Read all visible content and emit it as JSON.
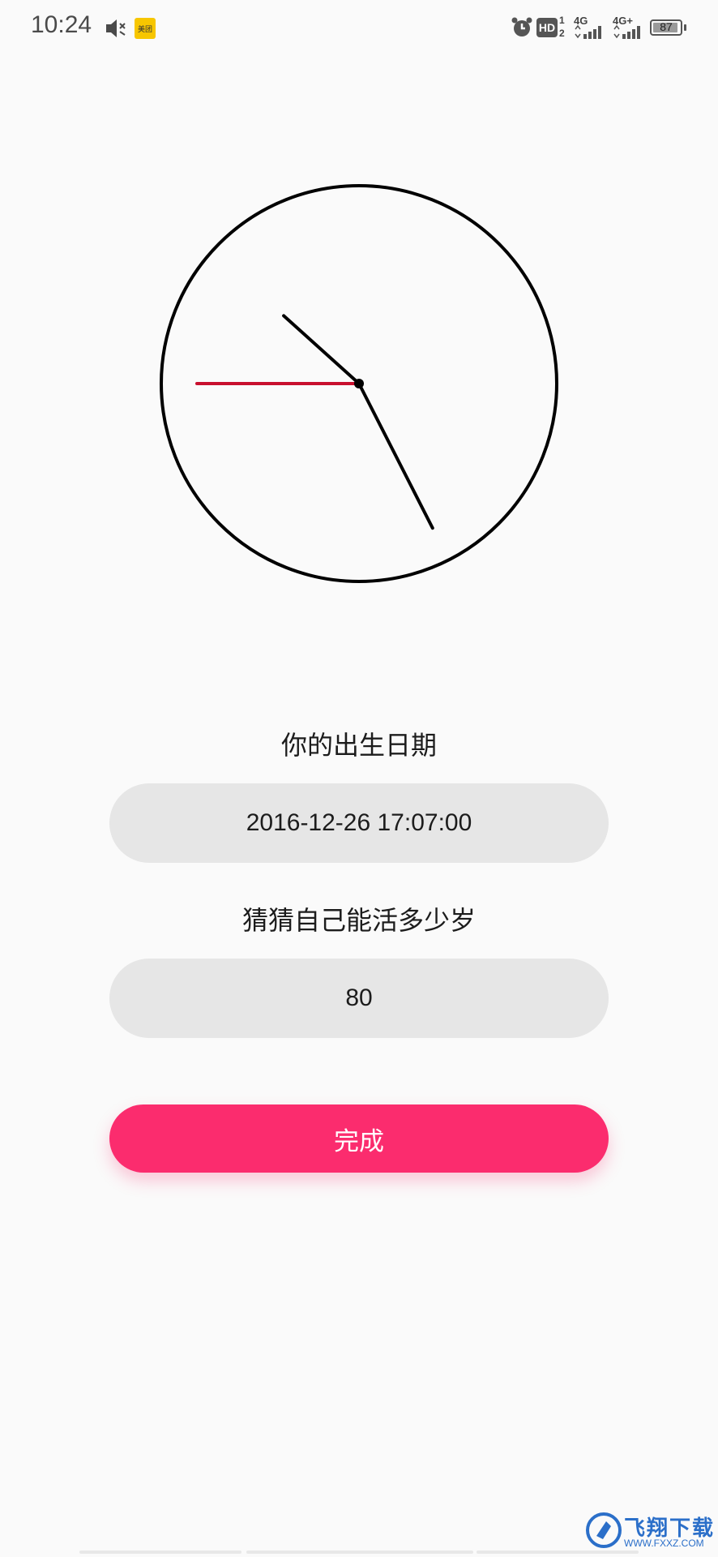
{
  "status_bar": {
    "time": "10:24",
    "app_icon_text": "美团",
    "hd_badge": "HD",
    "sim1_network": "4G",
    "sim2_network": "4G+",
    "battery_level": "87"
  },
  "clock": {
    "hour_hand_minutes": 52,
    "minute_hand_minutes": 25.5,
    "second_hand_seconds": 45,
    "colors": {
      "face": "#000000",
      "hands": "#000000",
      "second_hand": "#c8102e"
    }
  },
  "form": {
    "birth_label": "你的出生日期",
    "birth_value": "2016-12-26 17:07:00",
    "age_label": "猜猜自己能活多少岁",
    "age_value": "80",
    "submit_label": "完成"
  },
  "watermark": {
    "text": "飞翔下载",
    "url": "WWW.FXXZ.COM"
  },
  "colors": {
    "accent": "#fb2c6e",
    "pill_bg": "#e6e6e6",
    "background": "#fafafa"
  }
}
